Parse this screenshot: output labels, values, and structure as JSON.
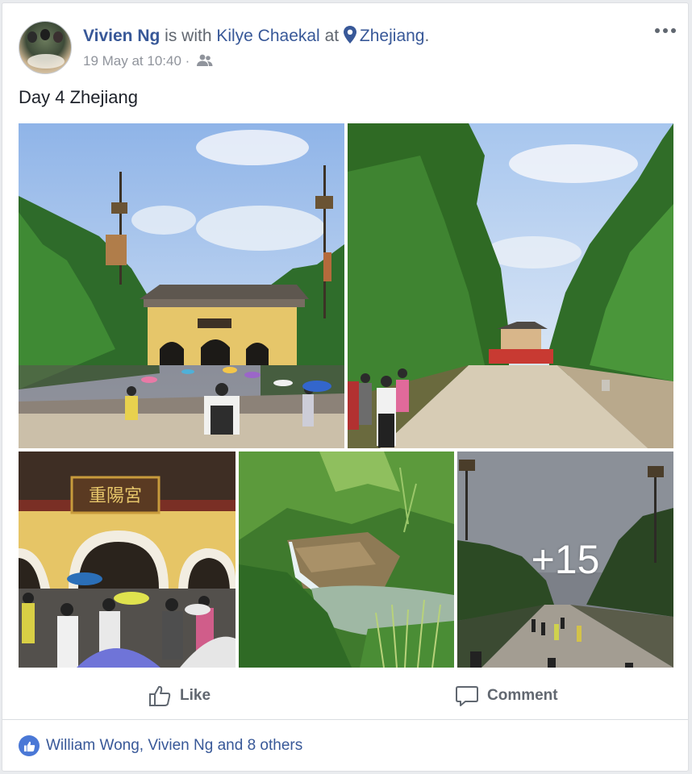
{
  "post": {
    "author": "Vivien Ng",
    "with_text": " is with ",
    "tagged": "Kilye Chaekal",
    "at_text": " at ",
    "location": "Zhejiang",
    "period": ".",
    "timestamp": "19 May at 10:40",
    "separator": " · ",
    "privacy_icon": "friends-icon",
    "text": "Day 4 Zhejiang"
  },
  "photos": {
    "more_count": "+15",
    "sign_text": "重陽宮"
  },
  "actions": {
    "like_label": "Like",
    "comment_label": "Comment"
  },
  "reactions": {
    "summary": "William Wong, Vivien Ng and 8 others"
  },
  "colors": {
    "link_blue": "#385898",
    "meta_grey": "#90949c",
    "like_blue": "#4a78d6"
  }
}
